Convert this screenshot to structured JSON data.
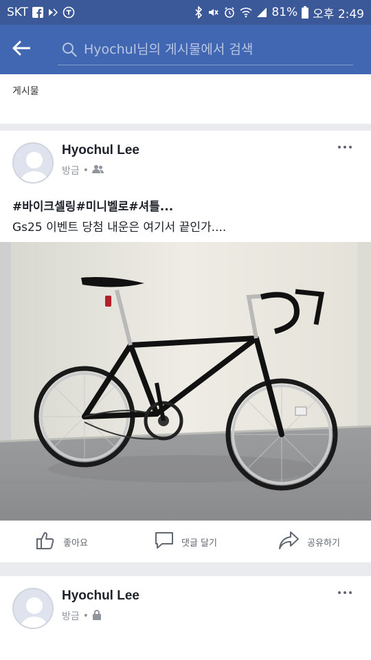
{
  "status_bar": {
    "carrier": "SKT",
    "battery": "81%",
    "time": "오후 2:49"
  },
  "search": {
    "placeholder": "Hyochul님의 게시물에서 검색"
  },
  "section": {
    "title": "게시물"
  },
  "posts": [
    {
      "author": "Hyochul Lee",
      "time": "방금",
      "privacy_icon": "friends-icon",
      "tags": "#바이크셀링#미니벨로#셔틀...",
      "body": "Gs25 이벤트 당첨 내운은 여기서 끝인가....",
      "actions": {
        "like": "좋아요",
        "comment": "댓글 달기",
        "share": "공유하기"
      }
    },
    {
      "author": "Hyochul Lee",
      "time": "방금",
      "privacy_icon": "lock-icon"
    }
  ],
  "colors": {
    "status_bg": "#3b5998",
    "header_bg": "#4267b2"
  }
}
